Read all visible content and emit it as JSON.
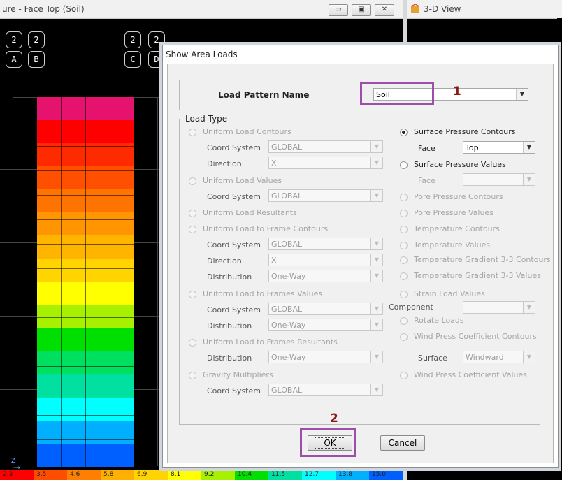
{
  "window_left": {
    "title": "ure - Face Top (Soil)",
    "buttons": [
      "▭",
      "▣",
      "✕"
    ]
  },
  "window_right": {
    "title": "3-D View"
  },
  "grid_bubbles": {
    "rows_top": [
      "2",
      "2",
      "2",
      "2"
    ],
    "rows_bottom": [
      "A",
      "B",
      "C",
      "D"
    ]
  },
  "contour_colors": [
    "#e5126e",
    "#ff0000",
    "#ff2a00",
    "#ff5000",
    "#ff7300",
    "#ff9500",
    "#ffb400",
    "#ffd400",
    "#ffff00",
    "#a6f000",
    "#00e000",
    "#00e060",
    "#00e0a0",
    "#00ffff",
    "#00b0ff",
    "#0060ff"
  ],
  "legend": {
    "values": [
      "2.3",
      "3.5",
      "4.6",
      "5.8",
      "6.9",
      "8.1",
      "9.2",
      "10.4",
      "11.5",
      "12.7",
      "13.8",
      "15.0"
    ],
    "colors": [
      "#ff0000",
      "#ff4d00",
      "#ff8000",
      "#ffb000",
      "#ffd400",
      "#ffff00",
      "#a6f000",
      "#00e000",
      "#00e0a0",
      "#00ffff",
      "#00b0ff",
      "#0060ff"
    ]
  },
  "dialog": {
    "title": "Show Area Loads",
    "load_pattern_label": "Load Pattern Name",
    "load_pattern_value": "Soil",
    "load_type_legend": "Load Type",
    "left_options": [
      "Uniform Load Contours",
      "Uniform  Load  Values",
      "Uniform Load Resultants",
      "Uniform Load to Frame Contours",
      "Uniform Load to Frames Values",
      "Uniform Load to Frames Resultants",
      "Gravity Multipliers"
    ],
    "labels": {
      "coord_system": "Coord System",
      "direction": "Direction",
      "distribution": "Distribution",
      "face": "Face",
      "component": "Component",
      "surface": "Surface"
    },
    "values": {
      "global": "GLOBAL",
      "x": "X",
      "one_way": "One-Way",
      "top": "Top",
      "windward": "Windward"
    },
    "right_options": [
      "Surface Pressure Contours",
      "Surface  Pressure Values",
      "Pore Pressure Contours",
      "Pore Pressure Values",
      "Temperature Contours",
      "Temperature Values",
      "Temperature Gradient 3-3 Contours",
      "Temperature Gradient 3-3 Values",
      "Strain Load Values",
      "Rotate Loads",
      "Wind Press Coefficient Contours",
      "Wind Press Coefficient Values"
    ],
    "ok_label": "OK",
    "cancel_label": "Cancel"
  },
  "annotations": {
    "step1": "1",
    "step2": "2",
    "highlight_color": "#9b4fa8",
    "number_color": "#8b1a1a"
  }
}
